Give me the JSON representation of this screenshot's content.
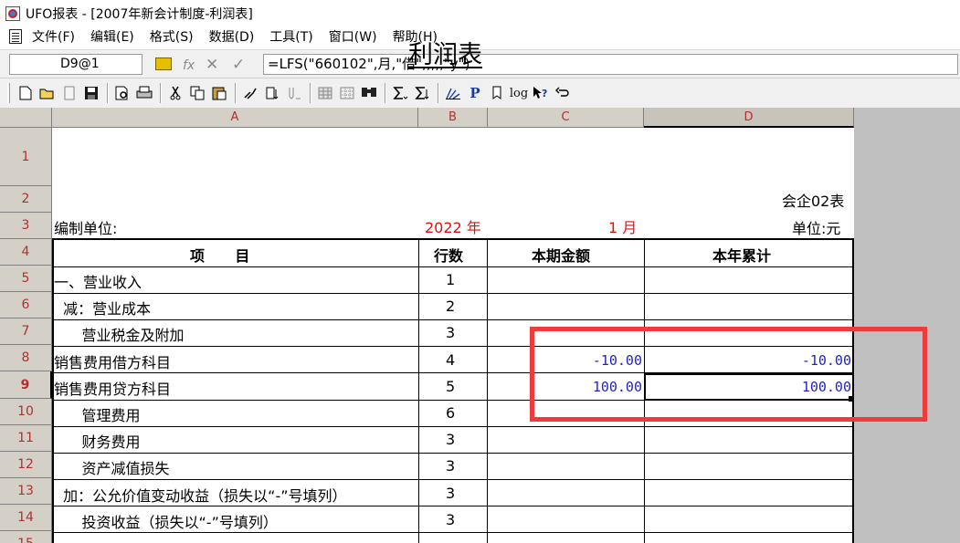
{
  "window": {
    "title": "UFO报表 - [2007年新会计制度-利润表]"
  },
  "menu": [
    "文件(F)",
    "编辑(E)",
    "格式(S)",
    "数据(D)",
    "工具(T)",
    "窗口(W)",
    "帮助(H)"
  ],
  "formula_bar": {
    "cell_ref": "D9@1",
    "fx_label": "fx",
    "formula": "=LFS(\"660102\",月,\"借\",,,,,\"y\")"
  },
  "toolbar": {
    "icons": [
      "new-icon",
      "open-icon",
      "blank-icon",
      "save-icon",
      "preview-icon",
      "print-icon",
      "cut-icon",
      "copy-icon",
      "paste-icon",
      "format-painter-icon",
      "insert-col-icon",
      "sort-icon",
      "fill-icon",
      "grid-icon",
      "find-icon",
      "sum-icon",
      "sum-area-icon",
      "chart-icon",
      "p-icon",
      "bookmark-icon",
      "log-icon",
      "help-icon",
      "undo-icon"
    ],
    "p_text": "P",
    "log_text": "log"
  },
  "grid": {
    "columns": [
      "A",
      "B",
      "C",
      "D"
    ],
    "active_column": "D",
    "rows": [
      "1",
      "2",
      "3",
      "4",
      "5",
      "6",
      "7",
      "8",
      "9",
      "10",
      "11",
      "12",
      "13",
      "14",
      "15"
    ],
    "active_row": "9"
  },
  "report": {
    "title": "利润表",
    "form_code": "会企02表",
    "preparer_label": "编制单位:",
    "year_value": "2022 年",
    "month_value": "1 月",
    "unit_label": "单位:元",
    "headers": {
      "item": "项      目",
      "line_no": "行数",
      "current": "本期金额",
      "ytd": "本年累计"
    },
    "rows": [
      {
        "item": "一、营业收入",
        "line": "1",
        "current": "",
        "ytd": ""
      },
      {
        "item": "  减：营业成本",
        "line": "2",
        "current": "",
        "ytd": ""
      },
      {
        "item": "      营业税金及附加",
        "line": "3",
        "current": "",
        "ytd": ""
      },
      {
        "item": "销售费用借方科目",
        "line": "4",
        "current": "-10.00",
        "ytd": "-10.00"
      },
      {
        "item": "销售费用贷方科目",
        "line": "5",
        "current": "100.00",
        "ytd": "100.00"
      },
      {
        "item": "      管理费用",
        "line": "6",
        "current": "",
        "ytd": ""
      },
      {
        "item": "      财务费用",
        "line": "3",
        "current": "",
        "ytd": ""
      },
      {
        "item": "      资产减值损失",
        "line": "3",
        "current": "",
        "ytd": ""
      },
      {
        "item": "  加：公允价值变动收益（损失以“-”号填列）",
        "line": "3",
        "current": "",
        "ytd": ""
      },
      {
        "item": "      投资收益（损失以“-”号填列）",
        "line": "3",
        "current": "",
        "ytd": ""
      }
    ]
  },
  "colors": {
    "annotation_box": "#ef3b3b",
    "value_blue": "#2222cc",
    "header_red": "#b03030"
  }
}
